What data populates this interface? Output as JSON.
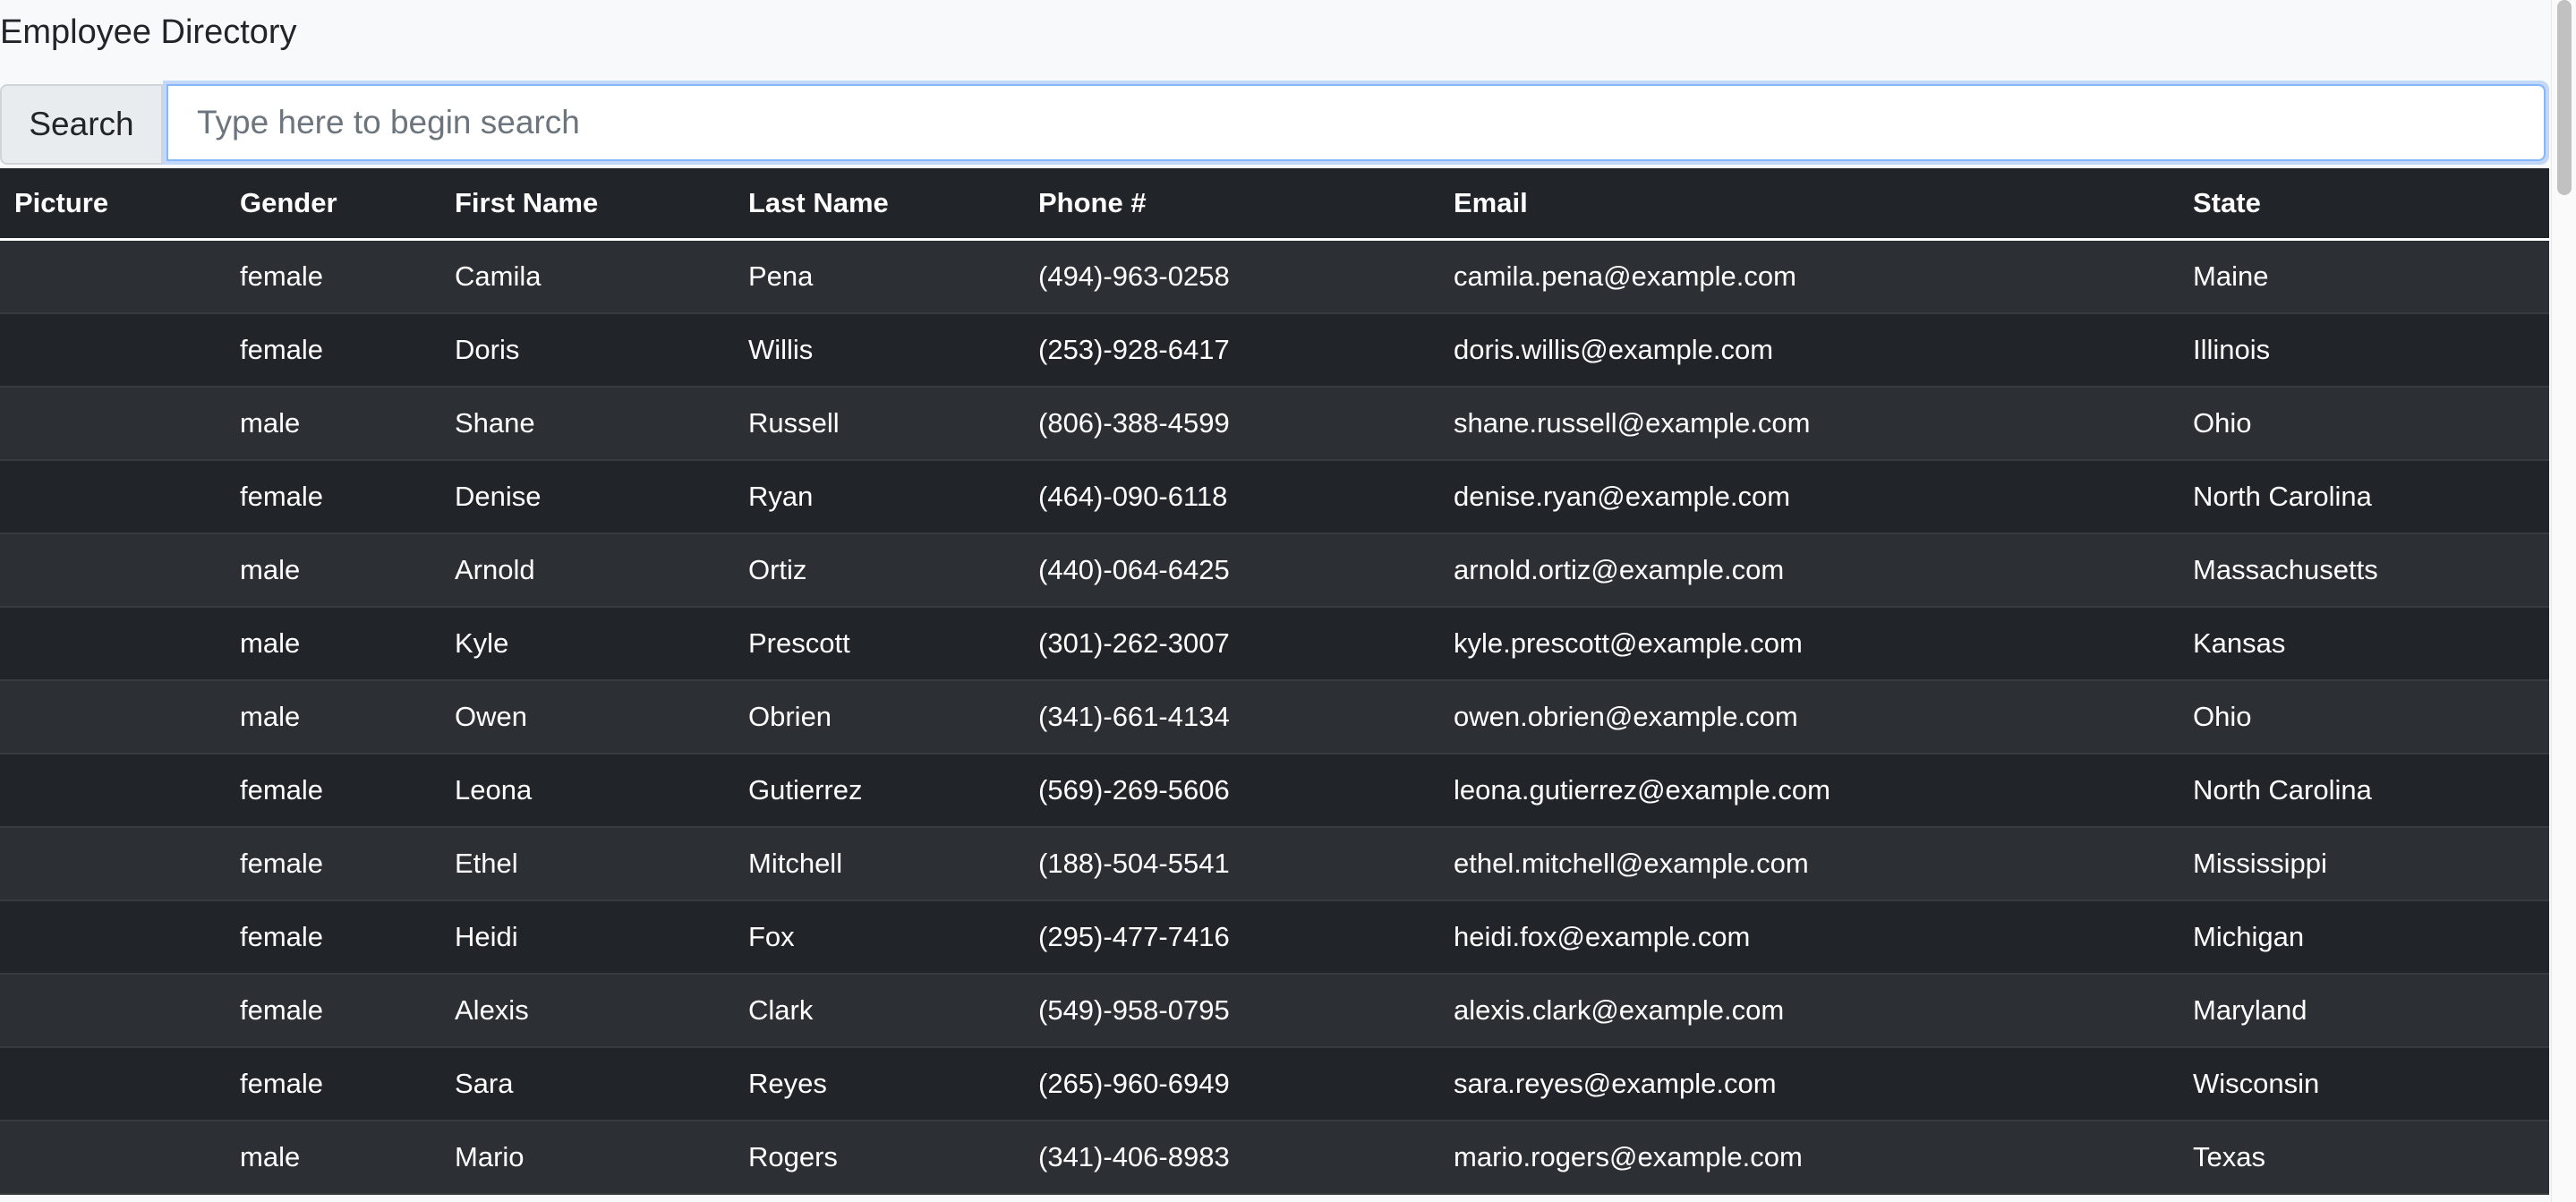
{
  "header": {
    "title": "Employee Directory"
  },
  "search": {
    "label": "Search",
    "placeholder": "Type here to begin search",
    "value": ""
  },
  "table": {
    "columns": [
      "Picture",
      "Gender",
      "First Name",
      "Last Name",
      "Phone #",
      "Email",
      "State"
    ],
    "rows": [
      {
        "picture": "",
        "gender": "female",
        "first": "Camila",
        "last": "Pena",
        "phone": "(494)-963-0258",
        "email": "camila.pena@example.com",
        "state": "Maine"
      },
      {
        "picture": "",
        "gender": "female",
        "first": "Doris",
        "last": "Willis",
        "phone": "(253)-928-6417",
        "email": "doris.willis@example.com",
        "state": "Illinois"
      },
      {
        "picture": "",
        "gender": "male",
        "first": "Shane",
        "last": "Russell",
        "phone": "(806)-388-4599",
        "email": "shane.russell@example.com",
        "state": "Ohio"
      },
      {
        "picture": "",
        "gender": "female",
        "first": "Denise",
        "last": "Ryan",
        "phone": "(464)-090-6118",
        "email": "denise.ryan@example.com",
        "state": "North Carolina"
      },
      {
        "picture": "",
        "gender": "male",
        "first": "Arnold",
        "last": "Ortiz",
        "phone": "(440)-064-6425",
        "email": "arnold.ortiz@example.com",
        "state": "Massachusetts"
      },
      {
        "picture": "",
        "gender": "male",
        "first": "Kyle",
        "last": "Prescott",
        "phone": "(301)-262-3007",
        "email": "kyle.prescott@example.com",
        "state": "Kansas"
      },
      {
        "picture": "",
        "gender": "male",
        "first": "Owen",
        "last": "Obrien",
        "phone": "(341)-661-4134",
        "email": "owen.obrien@example.com",
        "state": "Ohio"
      },
      {
        "picture": "",
        "gender": "female",
        "first": "Leona",
        "last": "Gutierrez",
        "phone": "(569)-269-5606",
        "email": "leona.gutierrez@example.com",
        "state": "North Carolina"
      },
      {
        "picture": "",
        "gender": "female",
        "first": "Ethel",
        "last": "Mitchell",
        "phone": "(188)-504-5541",
        "email": "ethel.mitchell@example.com",
        "state": "Mississippi"
      },
      {
        "picture": "",
        "gender": "female",
        "first": "Heidi",
        "last": "Fox",
        "phone": "(295)-477-7416",
        "email": "heidi.fox@example.com",
        "state": "Michigan"
      },
      {
        "picture": "",
        "gender": "female",
        "first": "Alexis",
        "last": "Clark",
        "phone": "(549)-958-0795",
        "email": "alexis.clark@example.com",
        "state": "Maryland"
      },
      {
        "picture": "",
        "gender": "female",
        "first": "Sara",
        "last": "Reyes",
        "phone": "(265)-960-6949",
        "email": "sara.reyes@example.com",
        "state": "Wisconsin"
      },
      {
        "picture": "",
        "gender": "male",
        "first": "Mario",
        "last": "Rogers",
        "phone": "(341)-406-8983",
        "email": "mario.rogers@example.com",
        "state": "Texas"
      }
    ]
  }
}
